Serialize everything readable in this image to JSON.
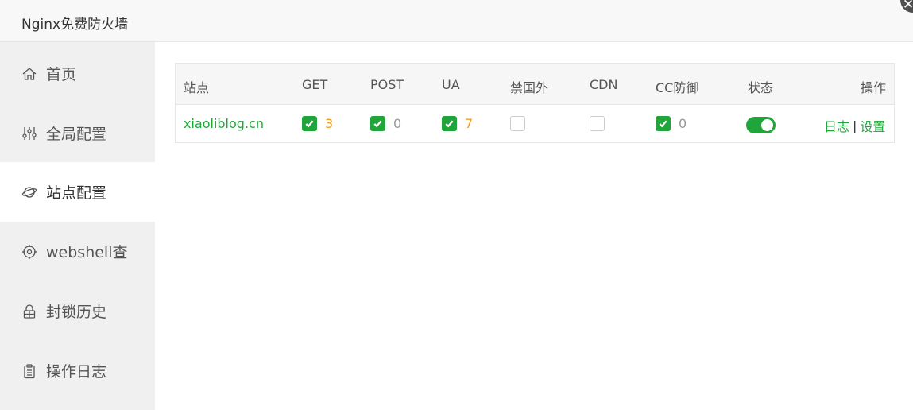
{
  "window": {
    "title": "Nginx免费防火墙",
    "close_icon": "close-icon"
  },
  "sidebar": {
    "items": [
      {
        "label": "首页",
        "icon": "home-icon"
      },
      {
        "label": "全局配置",
        "icon": "sliders-icon"
      },
      {
        "label": "站点配置",
        "icon": "globe-icon",
        "active": true
      },
      {
        "label": "webshell查",
        "icon": "target-icon"
      },
      {
        "label": "封锁历史",
        "icon": "lock-icon"
      },
      {
        "label": "操作日志",
        "icon": "clipboard-icon"
      }
    ]
  },
  "table": {
    "headers": {
      "site": "站点",
      "get": "GET",
      "post": "POST",
      "ua": "UA",
      "foreign": "禁国外",
      "cdn": "CDN",
      "cc": "CC防御",
      "status": "状态",
      "ops": "操作"
    },
    "rows": [
      {
        "site": "xiaoliblog.cn",
        "get": {
          "checked": true,
          "count": "3"
        },
        "post": {
          "checked": true,
          "count": "0"
        },
        "ua": {
          "checked": true,
          "count": "7"
        },
        "foreign": {
          "checked": false
        },
        "cdn": {
          "checked": false
        },
        "cc": {
          "checked": true,
          "count": "0"
        },
        "status": true,
        "log_label": "日志",
        "separator": "|",
        "settings_label": "设置"
      }
    ]
  },
  "colors": {
    "accent": "#20a53a",
    "hit_count": "#f0a020",
    "zero_count": "#999999"
  }
}
